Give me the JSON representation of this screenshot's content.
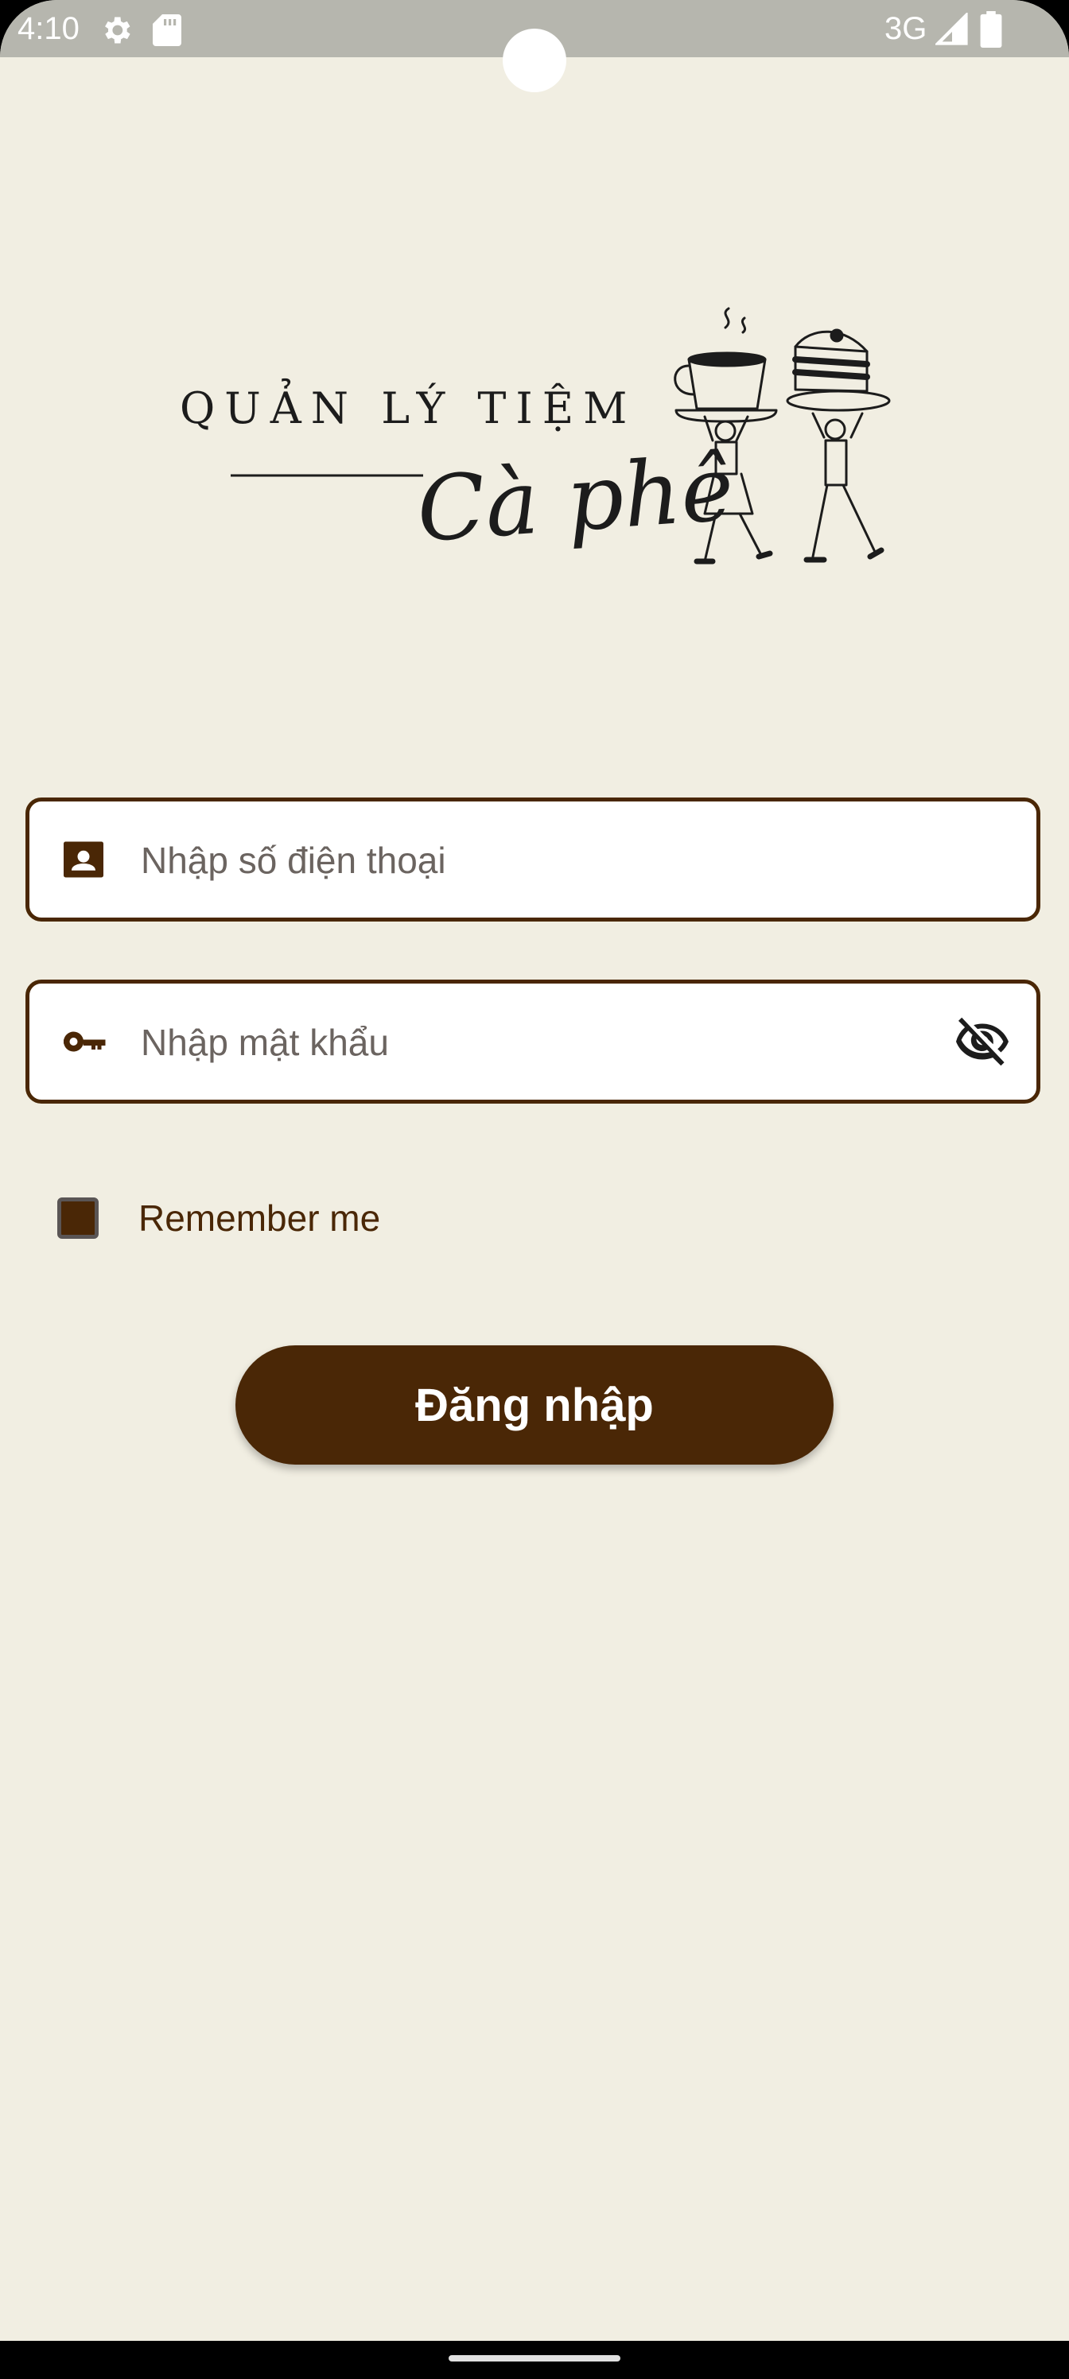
{
  "status_bar": {
    "time": "4:10",
    "network": "3G",
    "icons": [
      "gear-icon",
      "sd-card-icon",
      "signal-icon",
      "battery-icon"
    ]
  },
  "logo": {
    "line1": "QUẢN LÝ TIỆM",
    "line2": "Cà phê"
  },
  "form": {
    "phone_field": {
      "placeholder": "Nhập số điện thoại",
      "value": "",
      "icon": "contact-card-icon"
    },
    "password_field": {
      "placeholder": "Nhập mật khẩu",
      "value": "",
      "icon": "key-icon",
      "toggle_icon": "visibility-off-icon"
    },
    "remember": {
      "label": "Remember me",
      "checked": true
    },
    "login_button_label": "Đăng nhập"
  },
  "colors": {
    "background": "#f1eee2",
    "primary": "#4a2706",
    "status_bar": "#b6b6ae"
  }
}
